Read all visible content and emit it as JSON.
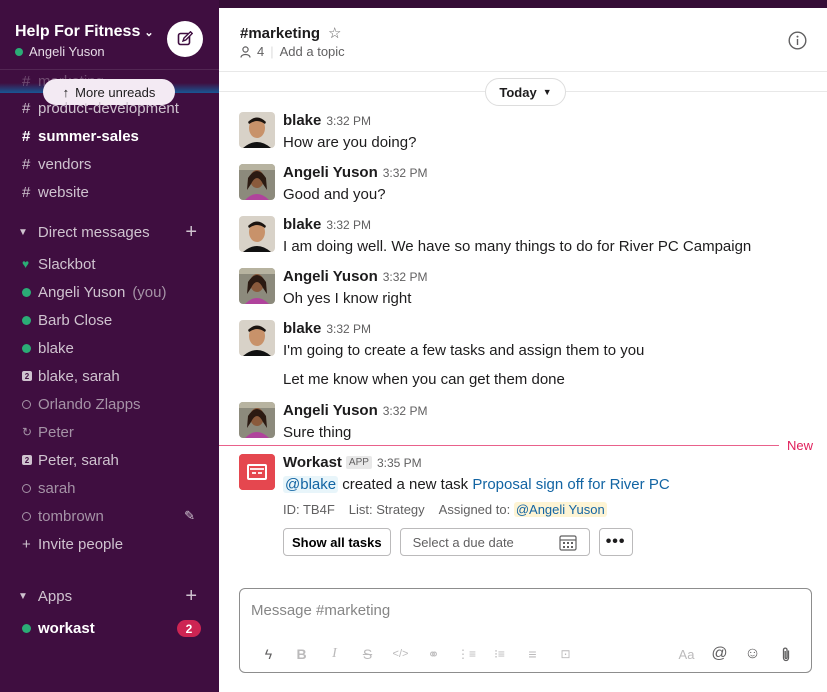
{
  "workspace": {
    "name": "Help For Fitness",
    "user": "Angeli Yuson"
  },
  "sidebar": {
    "more_unreads": "More unreads",
    "channels": [
      {
        "name": "marketing",
        "bold": false,
        "hidden": true
      },
      {
        "name": "product-development",
        "bold": false
      },
      {
        "name": "summer-sales",
        "bold": true
      },
      {
        "name": "vendors",
        "bold": false
      },
      {
        "name": "website",
        "bold": false
      }
    ],
    "dm_header": "Direct messages",
    "dms": [
      {
        "name": "Slackbot",
        "status": "heart"
      },
      {
        "name": "Angeli Yuson",
        "suffix": "(you)",
        "status": "online"
      },
      {
        "name": "Barb Close",
        "status": "online"
      },
      {
        "name": "blake",
        "status": "online"
      },
      {
        "name": "blake, sarah",
        "status": "group",
        "count": "2"
      },
      {
        "name": "Orlando Zlapps",
        "status": "away"
      },
      {
        "name": "Peter",
        "status": "away-c"
      },
      {
        "name": "Peter, sarah",
        "status": "group",
        "count": "2"
      },
      {
        "name": "sarah",
        "status": "away"
      },
      {
        "name": "tombrown",
        "status": "away"
      }
    ],
    "invite": "Invite people",
    "apps_header": "Apps",
    "apps": [
      {
        "name": "workast",
        "badge": "2"
      }
    ]
  },
  "channel": {
    "name": "#marketing",
    "members": "4",
    "topic": "Add a topic"
  },
  "today_label": "Today",
  "messages": [
    {
      "sender": "blake",
      "time": "3:32 PM",
      "lines": [
        "How are you doing?"
      ]
    },
    {
      "sender": "Angeli Yuson",
      "time": "3:32 PM",
      "lines": [
        "Good and you?"
      ]
    },
    {
      "sender": "blake",
      "time": "3:32 PM",
      "lines": [
        "I am doing well. We have so many things to do for River PC Campaign"
      ]
    },
    {
      "sender": "Angeli Yuson",
      "time": "3:32 PM",
      "lines": [
        "Oh yes I know right"
      ]
    },
    {
      "sender": "blake",
      "time": "3:32 PM",
      "lines": [
        "I'm going to create a few tasks and assign them to you",
        "Let me know when you can get them done"
      ]
    },
    {
      "sender": "Angeli Yuson",
      "time": "3:32 PM",
      "lines": [
        "Sure thing"
      ]
    }
  ],
  "new_label": "New",
  "app_message": {
    "sender": "Workast",
    "tag": "APP",
    "time": "3:35 PM",
    "mention": "@blake",
    "text": "created a new task",
    "task_link": "Proposal sign off for River PC",
    "id_label": "ID: TB4F",
    "list_label": "List: Strategy",
    "assigned_label": "Assigned to:",
    "assignee": "@Angeli Yuson",
    "show_all": "Show all tasks",
    "due_placeholder": "Select a due date",
    "more": "•••"
  },
  "composer": {
    "placeholder": "Message #marketing"
  },
  "colors": {
    "sidebar_bg": "#3f0e40",
    "accent_link": "#1264a3",
    "online": "#2bac76",
    "new_line": "#e01e5a",
    "badge": "#cd2553"
  }
}
